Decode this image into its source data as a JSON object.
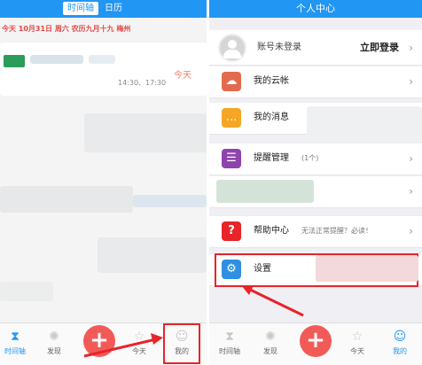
{
  "left": {
    "tabs": [
      {
        "label": "时间轴",
        "active": true
      },
      {
        "label": "日历",
        "active": false
      }
    ],
    "date_header": "今天 10月31日 周六 农历九月十九 梅州",
    "event": {
      "day_label": "今天",
      "time": "14:30、17:30"
    }
  },
  "right": {
    "title": "个人中心",
    "account": {
      "status": "账号未登录",
      "login": "立即登录"
    },
    "menu": [
      {
        "label": "我的云帐",
        "icon": "cloud-account-icon",
        "color": "#e26b4f"
      },
      {
        "label": "我的消息",
        "icon": "message-icon",
        "color": "#f5a623"
      },
      {
        "label": "提醒管理",
        "sub": "(1个)",
        "icon": "reminder-list-icon",
        "color": "#8e44ad"
      },
      {
        "label": "帮助中心",
        "sub": "无法正常提醒？必读！",
        "icon": "help-icon",
        "color": "#e8232a"
      },
      {
        "label": "设置",
        "icon": "gear-icon",
        "color": "#2f8fe0"
      }
    ]
  },
  "bottom_nav": {
    "items": [
      {
        "label": "时间轴",
        "icon": "hourglass-icon"
      },
      {
        "label": "发现",
        "icon": "bulb-icon"
      },
      {
        "label": "",
        "icon": "add-icon"
      },
      {
        "label": "今天",
        "icon": "today-icon"
      },
      {
        "label": "我的",
        "icon": "profile-icon"
      }
    ]
  },
  "colors": {
    "primary": "#2196f3",
    "accent_red": "#f25a58",
    "annotation_red": "#e8232a"
  }
}
